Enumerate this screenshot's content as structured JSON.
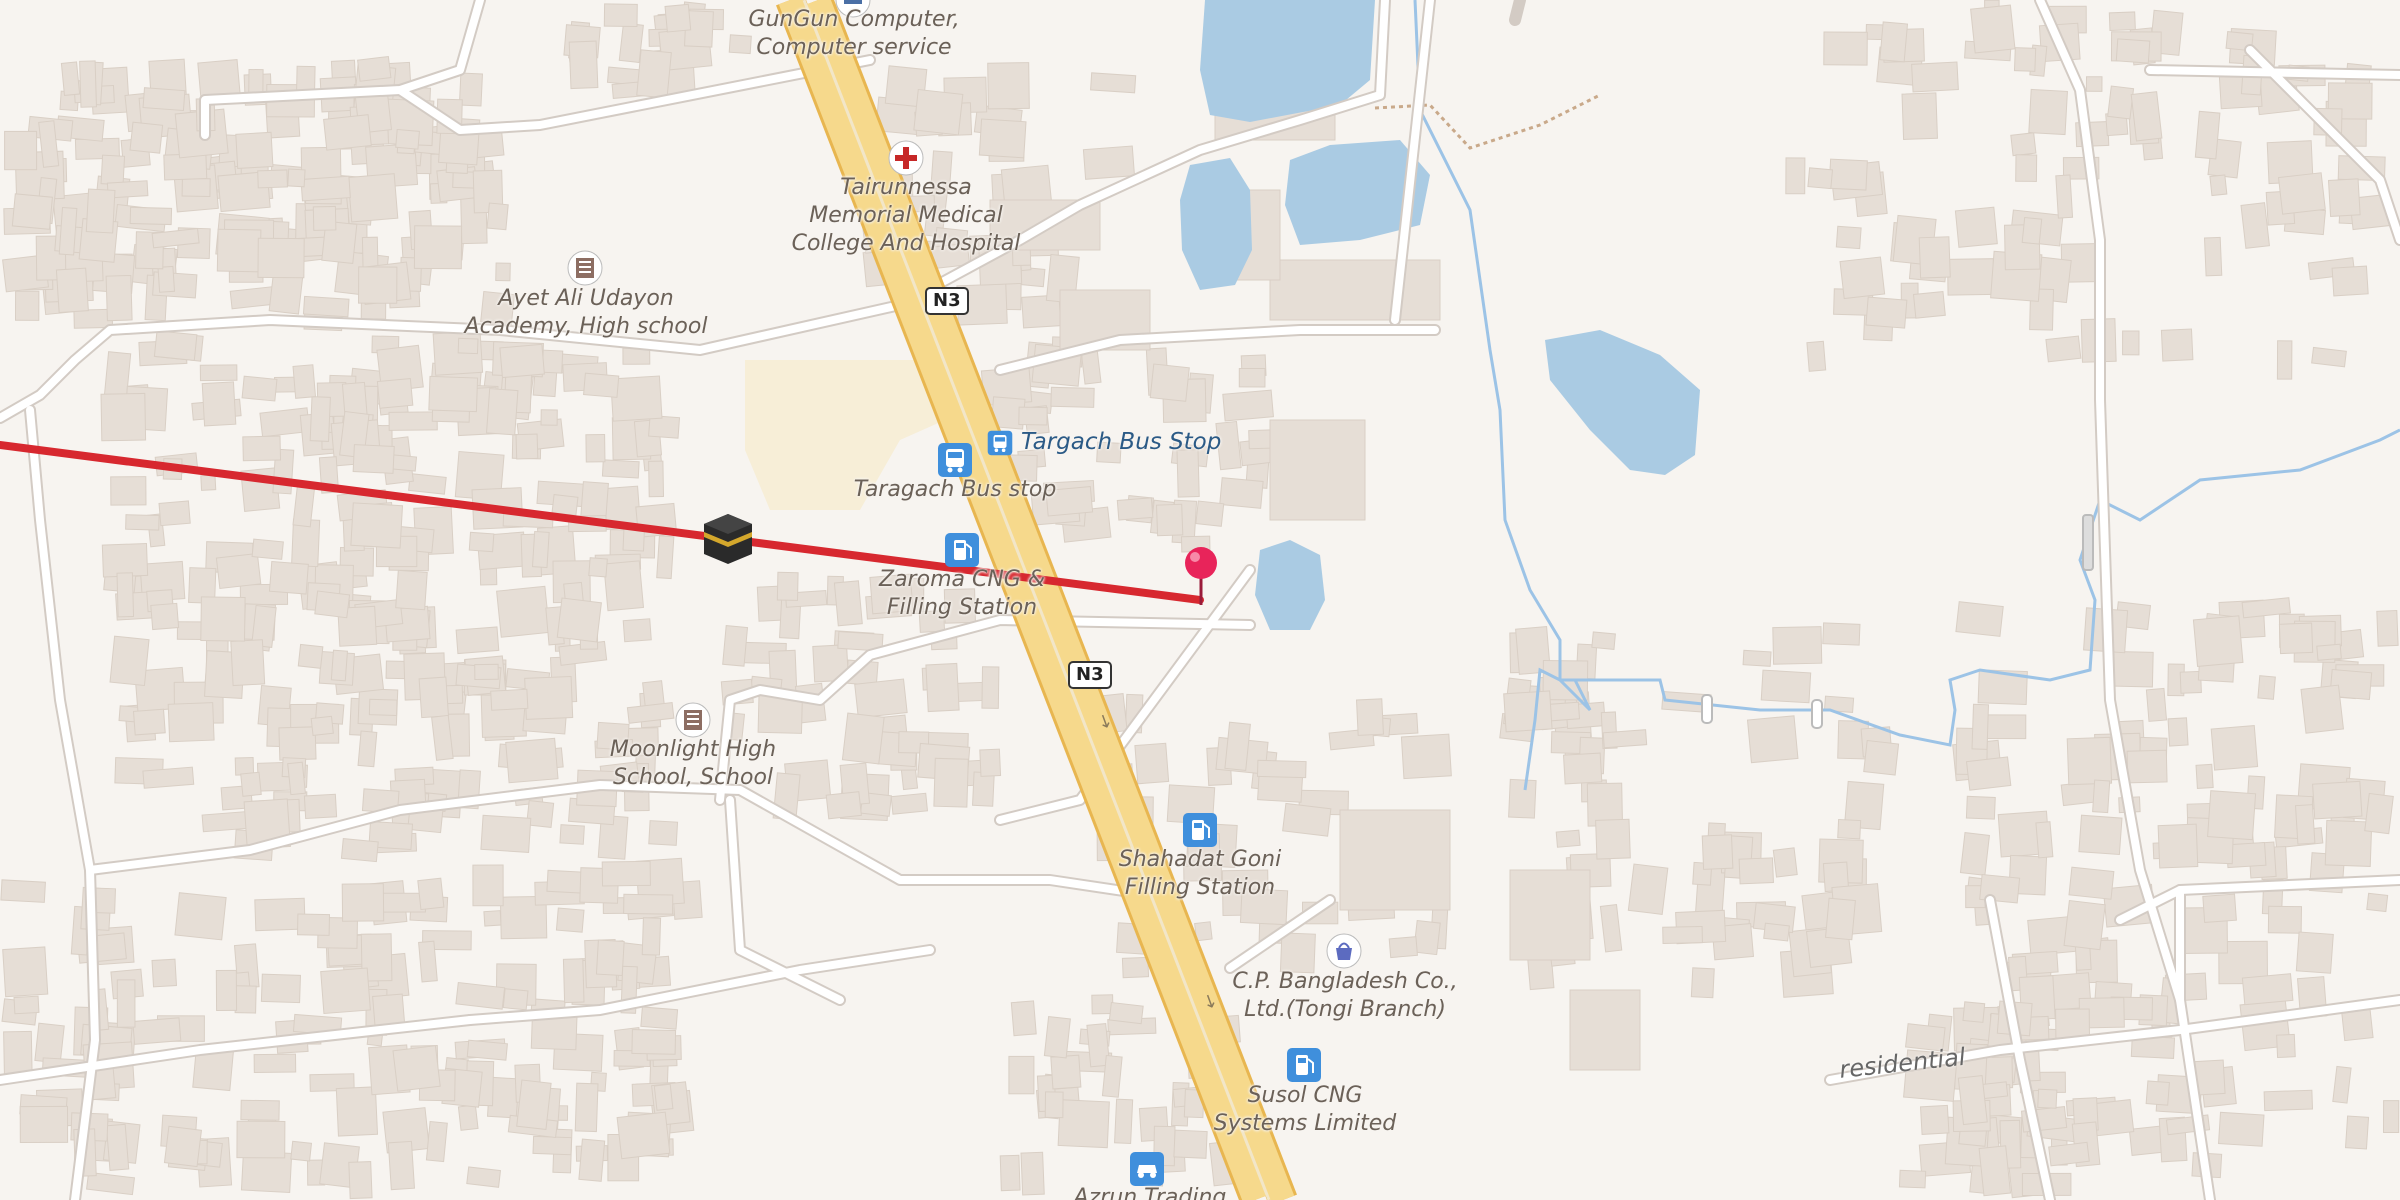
{
  "map": {
    "road_shields": [
      "N3",
      "N3"
    ],
    "street_labels": {
      "residential": "residential"
    },
    "places": {
      "gungun": [
        "GunGun Computer,",
        "Computer service"
      ],
      "hospital": [
        "Tairunnessa",
        "Memorial Medical",
        "College And Hospital"
      ],
      "academy": [
        "Ayet Ali Udayon",
        "Academy, High school"
      ],
      "targach_stop": "Targach Bus Stop",
      "taragach_stop": "Taragach Bus stop",
      "zaroma": [
        "Zaroma CNG &",
        "Filling Station"
      ],
      "moonlight": [
        "Moonlight High",
        "School, School"
      ],
      "shahadat": [
        "Shahadat Goni",
        "Filling Station"
      ],
      "cp": [
        "C.P. Bangladesh Co.,",
        "Ltd.(Tongi Branch)"
      ],
      "susol": [
        "Susol CNG",
        "Systems Limited"
      ],
      "azrun": "Azrun Trading"
    },
    "icons": [
      "hospital-icon",
      "school-icon",
      "bus-stop-icon",
      "fuel-station-icon",
      "shop-icon",
      "car-dealer-icon",
      "mosque-icon",
      "location-pin-icon"
    ],
    "colors": {
      "background": "#f7f4f0",
      "building": "#e6ded6",
      "water": "#aacbe3",
      "trunk_road": "#f6d98c",
      "trunk_road_casing": "#e8b650",
      "route_line": "#d7282f",
      "pin": "#e8245a",
      "poi_blue": "#3f8fdc"
    }
  }
}
